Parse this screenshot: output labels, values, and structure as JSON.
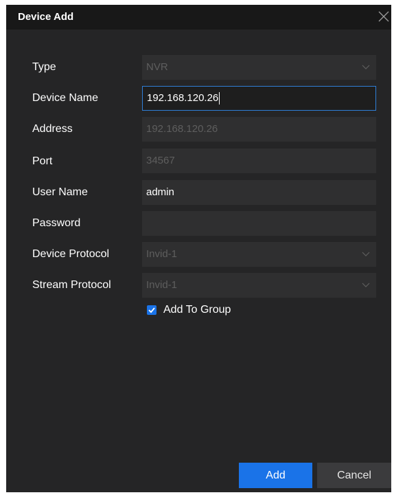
{
  "dialog": {
    "title": "Device Add"
  },
  "form": {
    "type": {
      "label": "Type",
      "value": "NVR"
    },
    "device_name": {
      "label": "Device Name",
      "value": "192.168.120.26"
    },
    "address": {
      "label": "Address",
      "value": "192.168.120.26"
    },
    "port": {
      "label": "Port",
      "value": "34567"
    },
    "user_name": {
      "label": "User Name",
      "value": "admin"
    },
    "password": {
      "label": "Password",
      "value": ""
    },
    "device_protocol": {
      "label": "Device Protocol",
      "value": "Invid-1"
    },
    "stream_protocol": {
      "label": "Stream Protocol",
      "value": "Invid-1"
    },
    "add_to_group": {
      "label": "Add To Group",
      "checked": true
    }
  },
  "buttons": {
    "add": "Add",
    "cancel": "Cancel"
  },
  "colors": {
    "dialog_bg": "#252526",
    "titlebar_bg": "#181818",
    "accent": "#1a73e8",
    "focus_border": "#2f7fd8"
  }
}
